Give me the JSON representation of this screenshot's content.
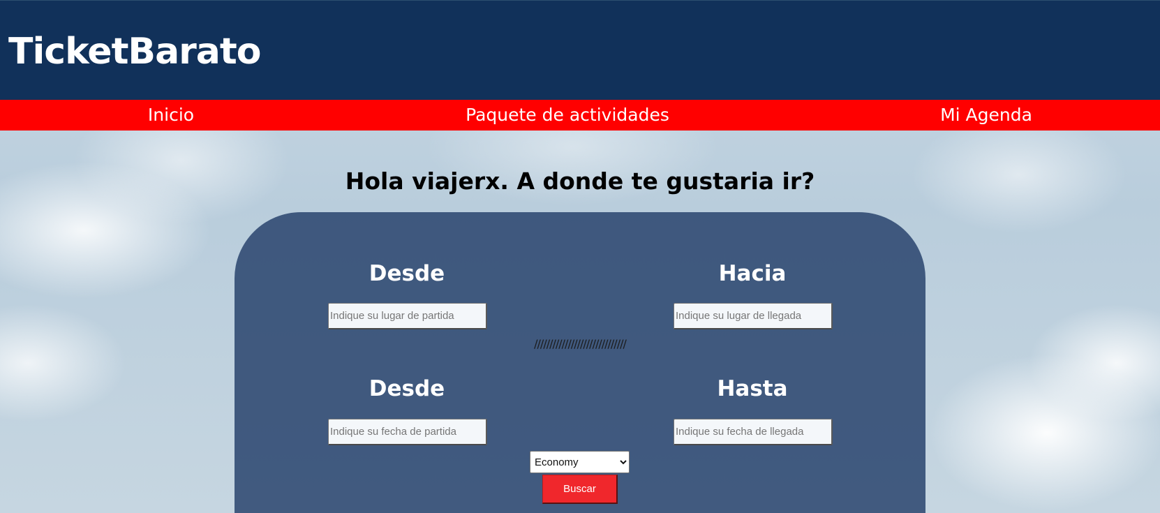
{
  "header": {
    "logo": "TicketBarato",
    "background_color": "#11315a"
  },
  "nav": {
    "background_color": "#ff0000",
    "items": [
      {
        "label": "Inicio"
      },
      {
        "label": "Paquete de actividades"
      },
      {
        "label": "Mi Agenda"
      }
    ]
  },
  "main": {
    "greeting": "Hola viajerx. A donde te gustaria ir?"
  },
  "search_form": {
    "origin_label": "Desde",
    "destination_label": "Hacia",
    "origin_placeholder": "Indique su lugar de partida",
    "destination_placeholder": "Indique su lugar de llegada",
    "origin_value": "",
    "destination_value": "",
    "divider": "//////////////////////////////",
    "start_date_label": "Desde",
    "end_date_label": "Hasta",
    "start_date_placeholder": "Indique su fecha de partida",
    "end_date_placeholder": "Indique su fecha de llegada",
    "start_date_value": "",
    "end_date_value": "",
    "class_selected": "Economy",
    "search_button": "Buscar",
    "button_color": "#f0272c"
  }
}
